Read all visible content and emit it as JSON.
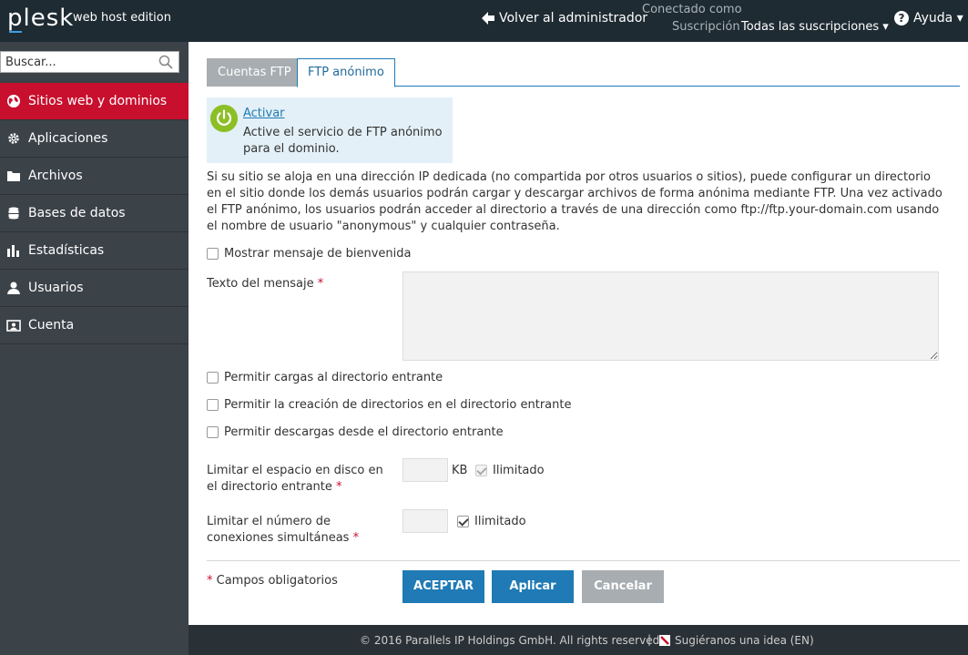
{
  "topbar": {
    "logo": "plesk",
    "edition": "web host edition",
    "back_label": "Volver al administrador",
    "connected_as": "Conectado como",
    "subscription_label": "Suscripción",
    "subscription_value": "Todas las suscripciones ▾",
    "help_label": "Ayuda ▾"
  },
  "sidebar": {
    "search_placeholder": "Buscar...",
    "items": [
      {
        "label": "Sitios web y dominios",
        "icon": "globe-icon"
      },
      {
        "label": "Aplicaciones",
        "icon": "gear-icon"
      },
      {
        "label": "Archivos",
        "icon": "folder-icon"
      },
      {
        "label": "Bases de datos",
        "icon": "database-icon"
      },
      {
        "label": "Estadísticas",
        "icon": "bar-chart-icon"
      },
      {
        "label": "Usuarios",
        "icon": "user-icon"
      },
      {
        "label": "Cuenta",
        "icon": "account-icon"
      }
    ]
  },
  "tabs": {
    "ftp_accounts": "Cuentas FTP",
    "anonymous_ftp": "FTP anónimo"
  },
  "activate": {
    "link": "Activar",
    "description": "Active el servicio de FTP anónimo para el dominio."
  },
  "info_text": "Si su sitio se aloja en una dirección IP dedicada (no compartida por otros usuarios o sitios), puede configurar un directorio en el sitio donde los demás usuarios podrán cargar y descargar archivos de forma anónima mediante FTP. Una vez activado el FTP anónimo, los usuarios podrán acceder al directorio a través de una dirección como ftp://ftp.your-domain.com usando el nombre de usuario \"anonymous\" y cualquier contraseña.",
  "form": {
    "show_welcome": "Mostrar mensaje de bienvenida",
    "message_text_label": "Texto del mensaje",
    "required_mark": "*",
    "allow_uploads": "Permitir cargas al directorio entrante",
    "allow_dir_creation": "Permitir la creación de directorios en el directorio entrante",
    "allow_downloads": "Permitir descargas desde el directorio entrante",
    "disk_limit_label": "Limitar el espacio en disco en el directorio entrante",
    "disk_unit": "KB",
    "unlimited": "Ilimitado",
    "conn_limit_label": "Limitar el número de conexiones simultáneas",
    "required_fields": "Campos obligatorios"
  },
  "buttons": {
    "ok": "ACEPTAR",
    "apply": "Aplicar",
    "cancel": "Cancelar"
  },
  "footer": {
    "copyright": "© 2016 Parallels IP Holdings GmbH. All rights reserved.",
    "separator": "|",
    "suggest": "Sugiéranos una idea (EN)"
  }
}
